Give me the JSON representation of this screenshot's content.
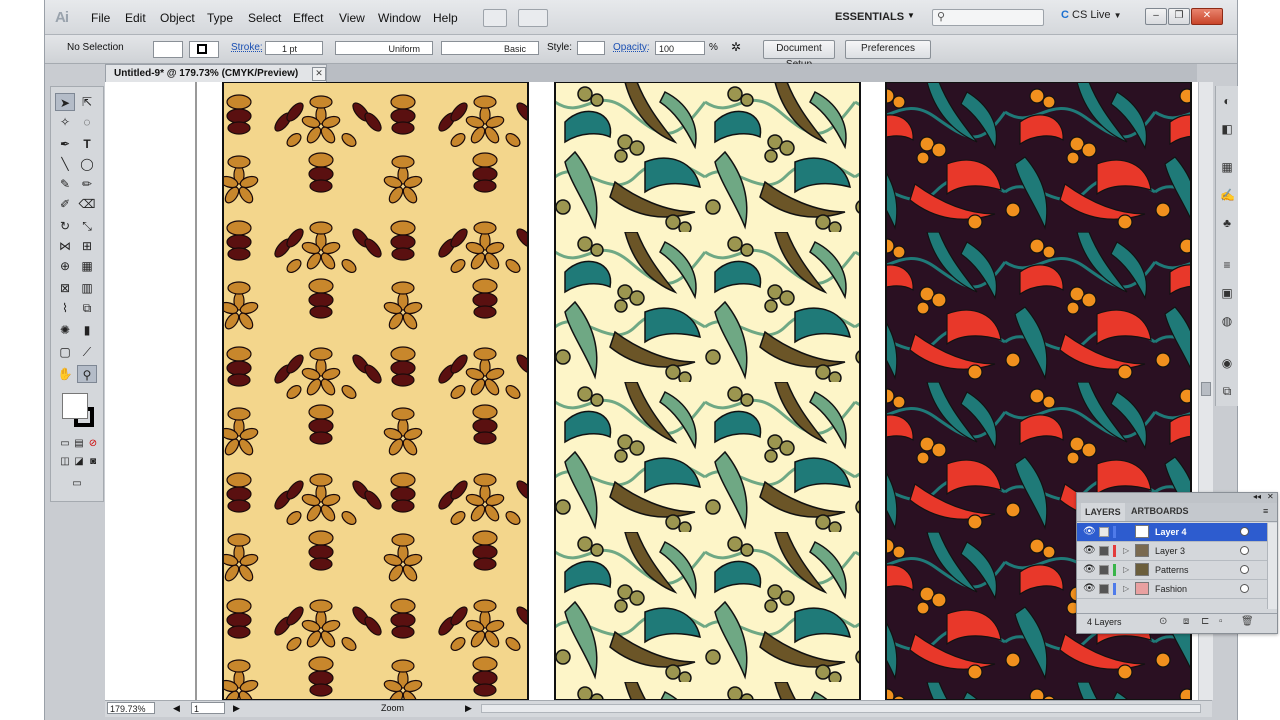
{
  "app": {
    "logo": "Ai",
    "workspace": "ESSENTIALS",
    "cs_live": "CS Live"
  },
  "menu": [
    "File",
    "Edit",
    "Object",
    "Type",
    "Select",
    "Effect",
    "View",
    "Window",
    "Help"
  ],
  "control_bar": {
    "selection": "No Selection",
    "stroke_label": "Stroke:",
    "stroke_value": "1 pt",
    "profile": "Uniform",
    "brush": "Basic",
    "style_label": "Style:",
    "opacity_label": "Opacity:",
    "opacity_value": "100",
    "opacity_unit": "%",
    "document_setup": "Document Setup",
    "preferences": "Preferences"
  },
  "document": {
    "title": "Untitled-9* @ 179.73% (CMYK/Preview)",
    "close": "✕"
  },
  "status": {
    "zoom": "179.73%",
    "artboard": "1",
    "tool": "Zoom"
  },
  "layers_panel": {
    "tabs": [
      "LAYERS",
      "ARTBOARDS"
    ],
    "layers": [
      {
        "name": "Layer 4",
        "color": "#4f7bea",
        "selected": true,
        "thumb": "#ffffff"
      },
      {
        "name": "Layer 3",
        "color": "#e33b3b",
        "selected": false,
        "thumb": "#7a6a50"
      },
      {
        "name": "Patterns",
        "color": "#39b54a",
        "selected": false,
        "thumb": "#6b5e3c"
      },
      {
        "name": "Fashion",
        "color": "#4f7bea",
        "selected": false,
        "thumb": "#e8a0a0"
      }
    ],
    "count": "4 Layers"
  },
  "colors": {
    "panel1_bg": "#f3d68c",
    "panel1_flower": "#c8872c",
    "panel1_dark": "#5a1010",
    "panel2_bg": "#fdf5c8",
    "panel2_teal": "#1f7a78",
    "panel2_green": "#6fa884",
    "panel2_brown": "#6b5527",
    "panel2_olive": "#9c9650",
    "panel3_bg": "#2a1022",
    "panel3_red": "#e8382a",
    "panel3_orange": "#f0901e",
    "panel3_teal": "#1f7a78"
  }
}
